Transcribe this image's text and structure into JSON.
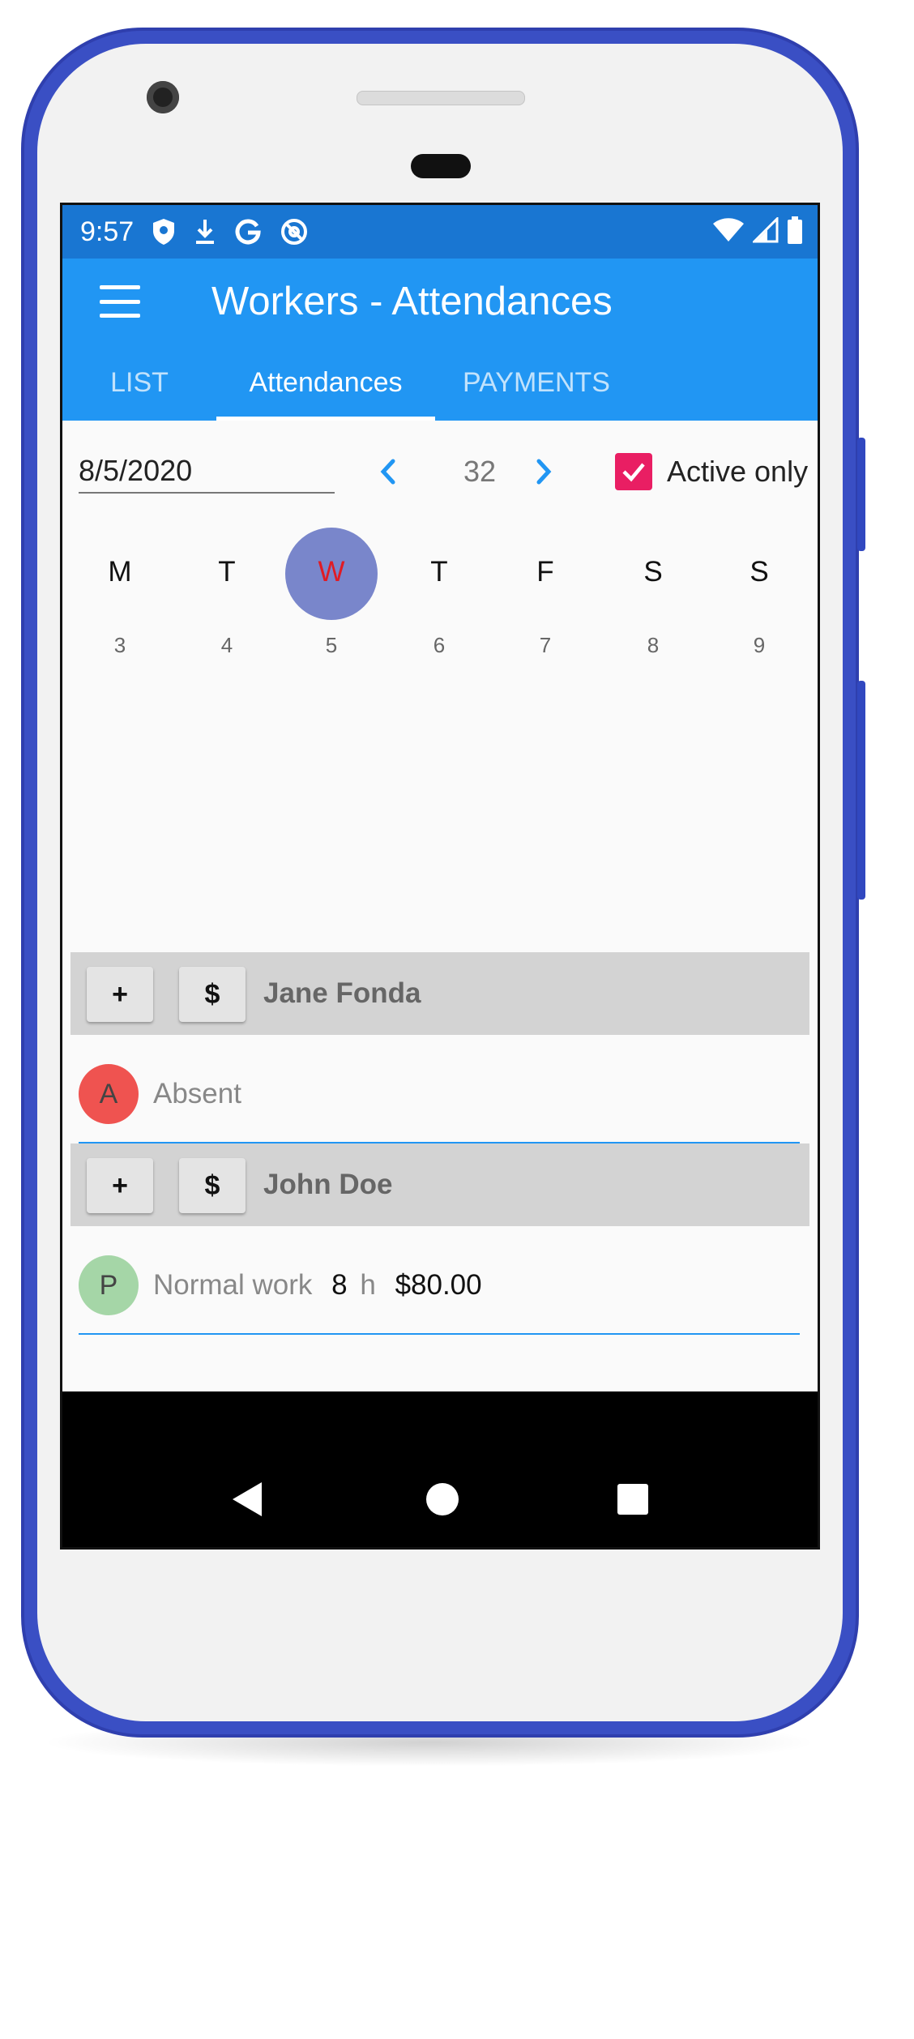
{
  "status_bar": {
    "time": "9:57",
    "left_icons": [
      "shield-icon",
      "download-icon",
      "google-icon",
      "at-sign-icon"
    ],
    "right_icons": [
      "wifi-icon",
      "signal-icon",
      "battery-icon"
    ]
  },
  "app_bar": {
    "title": "Workers - Attendances"
  },
  "tabs": [
    {
      "label": "LIST",
      "active": false
    },
    {
      "label": "Attendances",
      "active": true
    },
    {
      "label": "PAYMENTS",
      "active": false
    }
  ],
  "filter": {
    "date": "8/5/2020",
    "week_number": "32",
    "active_only_label": "Active only",
    "active_only_checked": true
  },
  "week": {
    "days": [
      {
        "letter": "M",
        "number": "3"
      },
      {
        "letter": "T",
        "number": "4"
      },
      {
        "letter": "W",
        "number": "5"
      },
      {
        "letter": "T",
        "number": "6"
      },
      {
        "letter": "F",
        "number": "7"
      },
      {
        "letter": "S",
        "number": "8"
      },
      {
        "letter": "S",
        "number": "9"
      }
    ],
    "selected_index": 2
  },
  "workers": [
    {
      "name": "Jane Fonda",
      "add_label": "+",
      "pay_label": "$",
      "attendance": {
        "avatar_letter": "A",
        "avatar_color": "#ef5350",
        "type": "Absent",
        "hours": "",
        "hours_unit": "",
        "amount": ""
      }
    },
    {
      "name": "John Doe",
      "add_label": "+",
      "pay_label": "$",
      "attendance": {
        "avatar_letter": "P",
        "avatar_color": "#a5d6a7",
        "type": "Normal work",
        "hours": "8",
        "hours_unit": "h",
        "amount": "$80.00"
      }
    }
  ],
  "colors": {
    "primary": "#2196f3",
    "status_bar": "#1976d2",
    "accent": "#e91e63",
    "selected_day": "#7986cb",
    "phone_frame": "#3a4fc4"
  }
}
